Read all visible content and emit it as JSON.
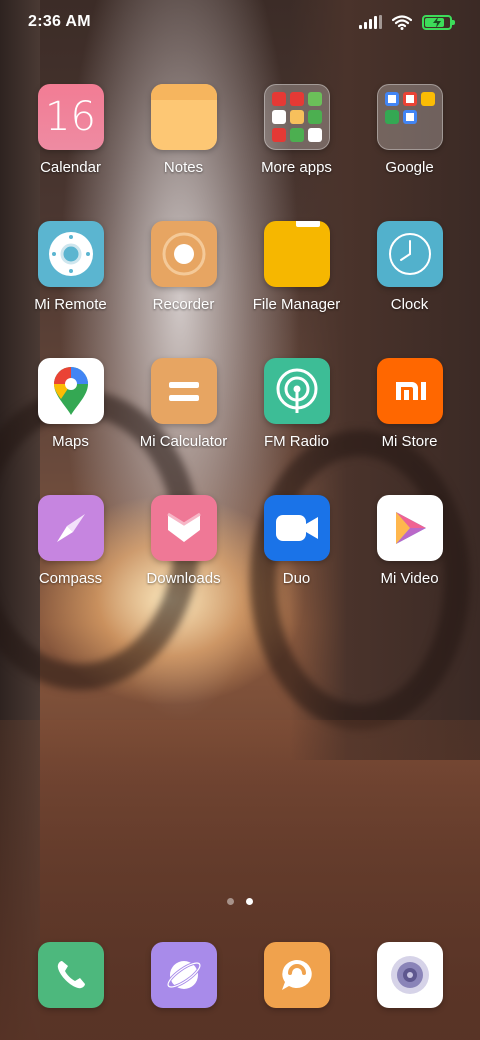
{
  "status_bar": {
    "time": "2:36 AM",
    "icons": [
      "signal-icon",
      "wifi-icon",
      "battery-charging-icon"
    ],
    "battery_level": 0.8
  },
  "apps": [
    {
      "label": "Calendar",
      "icon": "calendar-icon",
      "icon_text": "16",
      "color": "#f07f93"
    },
    {
      "label": "Notes",
      "icon": "notes-icon",
      "color": "#fdc774"
    },
    {
      "label": "More apps",
      "icon": "folder-icon"
    },
    {
      "label": "Google",
      "icon": "folder-icon"
    },
    {
      "label": "Mi Remote",
      "icon": "remote-icon",
      "color": "#5bb5d0"
    },
    {
      "label": "Recorder",
      "icon": "recorder-icon",
      "color": "#e7a562"
    },
    {
      "label": "File Manager",
      "icon": "folder-file-icon",
      "color": "#f6b700"
    },
    {
      "label": "Clock",
      "icon": "clock-icon",
      "color": "#52b1cc"
    },
    {
      "label": "Maps",
      "icon": "map-pin-icon",
      "color": "#ffffff"
    },
    {
      "label": "Mi Calculator",
      "icon": "calculator-icon",
      "color": "#e7a562"
    },
    {
      "label": "FM Radio",
      "icon": "radio-icon",
      "color": "#3dbd96"
    },
    {
      "label": "Mi Store",
      "icon": "mi-logo-icon",
      "icon_text": "mi",
      "color": "#ff6700"
    },
    {
      "label": "Compass",
      "icon": "compass-icon",
      "color": "#c685e0"
    },
    {
      "label": "Downloads",
      "icon": "download-icon",
      "color": "#ef7896"
    },
    {
      "label": "Duo",
      "icon": "video-camera-icon",
      "color": "#1a73e8"
    },
    {
      "label": "Mi Video",
      "icon": "play-icon",
      "color": "#ffffff"
    }
  ],
  "page_indicator": {
    "count": 2,
    "active": 2
  },
  "dock": [
    {
      "icon": "phone-icon",
      "color": "#4db87d"
    },
    {
      "icon": "browser-icon",
      "color": "#a88bea"
    },
    {
      "icon": "message-icon",
      "color": "#f0a24d"
    },
    {
      "icon": "camera-icon",
      "color": "#ffffff"
    }
  ]
}
